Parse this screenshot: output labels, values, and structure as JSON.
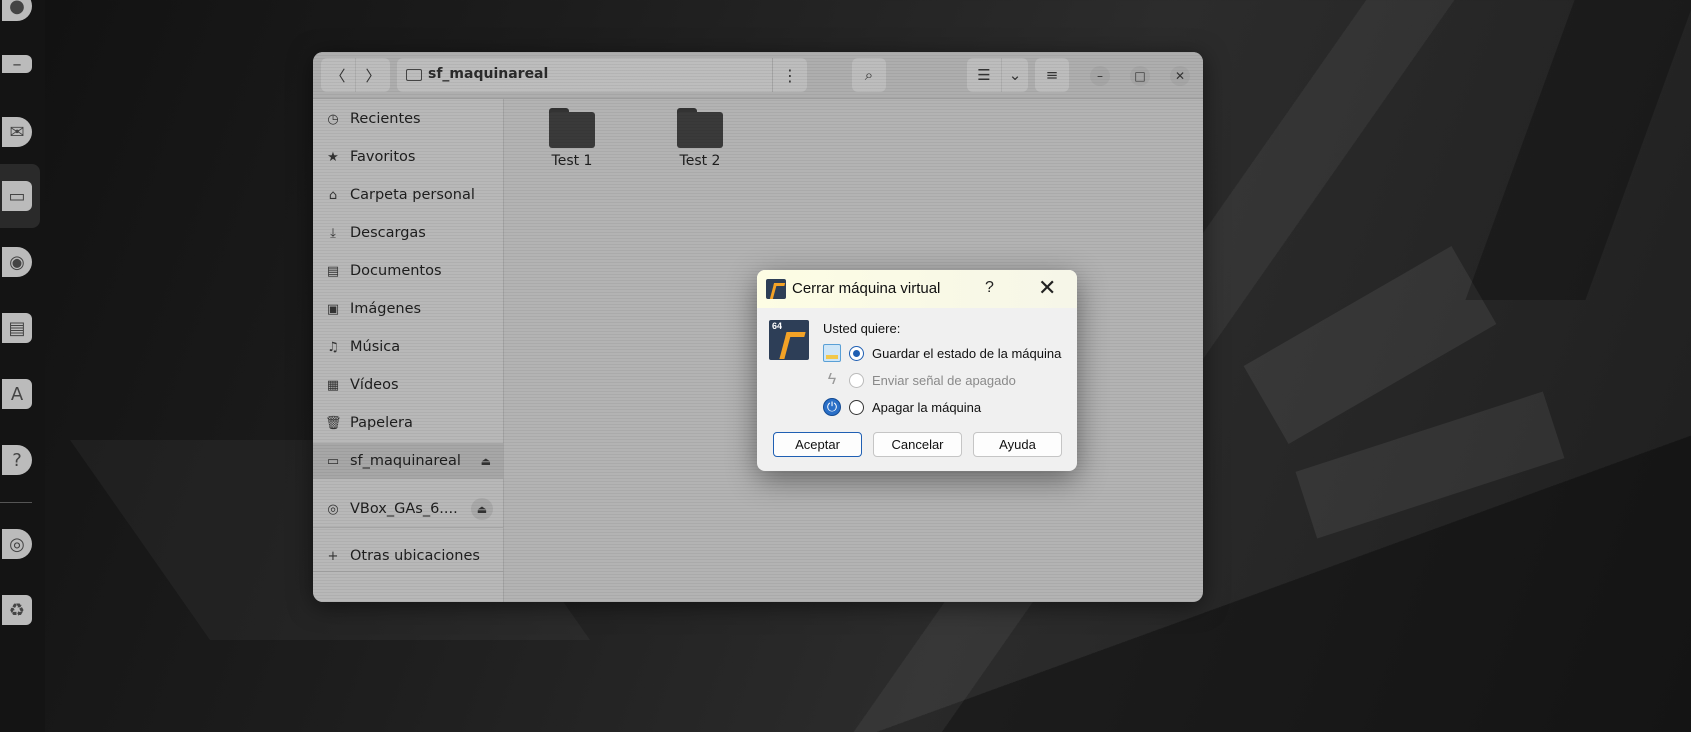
{
  "file_manager": {
    "path_title": "sf_maquinareal",
    "nav": {
      "back_icon": "chevron-left-icon",
      "forward_icon": "chevron-right-icon"
    },
    "sidebar": {
      "items": [
        {
          "label": "Recientes",
          "icon": "clock-icon"
        },
        {
          "label": "Favoritos",
          "icon": "star-icon"
        },
        {
          "label": "Carpeta personal",
          "icon": "home-icon"
        },
        {
          "label": "Descargas",
          "icon": "download-icon"
        },
        {
          "label": "Documentos",
          "icon": "document-icon"
        },
        {
          "label": "Imágenes",
          "icon": "image-icon"
        },
        {
          "label": "Música",
          "icon": "music-icon"
        },
        {
          "label": "Vídeos",
          "icon": "video-icon"
        },
        {
          "label": "Papelera",
          "icon": "trash-icon"
        },
        {
          "label": "sf_maquinareal",
          "icon": "drive-icon"
        },
        {
          "label": "VBox_GAs_6....",
          "icon": "disc-icon"
        },
        {
          "label": "Otras ubicaciones",
          "icon": "plus-icon"
        }
      ]
    },
    "folders": [
      {
        "label": "Test 1"
      },
      {
        "label": "Test 2"
      }
    ]
  },
  "dialog": {
    "title": "Cerrar máquina virtual",
    "help_label": "?",
    "close_label": "✕",
    "logo_badge": "64",
    "prompt": "Usted quiere:",
    "options": [
      {
        "label": "Guardar el estado de la máquina",
        "selected": true,
        "enabled": true,
        "icon": "save-state-icon"
      },
      {
        "label": "Enviar señal de apagado",
        "selected": false,
        "enabled": false,
        "icon": "lightning-icon"
      },
      {
        "label": "Apagar la máquina",
        "selected": false,
        "enabled": true,
        "icon": "power-icon"
      }
    ],
    "buttons": {
      "accept": "Aceptar",
      "cancel": "Cancelar",
      "help": "Ayuda"
    },
    "accent_color": "#1f5fb3"
  }
}
